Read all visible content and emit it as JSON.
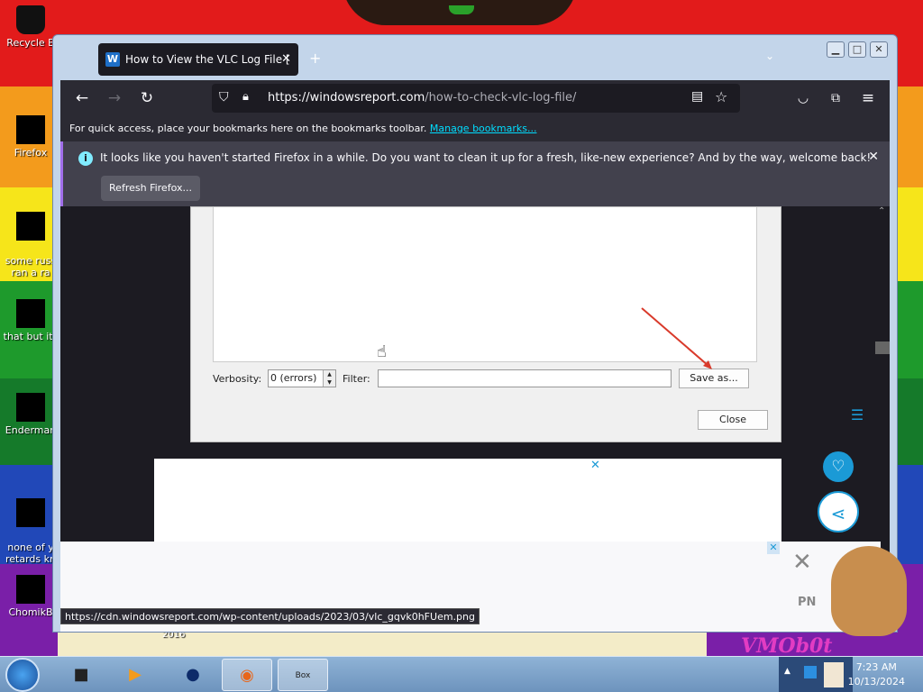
{
  "desktop": {
    "icons": [
      {
        "label": "Recycle B"
      },
      {
        "label": "Firefox"
      },
      {
        "label": "some russ\nran a ra"
      },
      {
        "label": "that but its"
      },
      {
        "label": "Enderman"
      },
      {
        "label": "none of y\nretards kn"
      },
      {
        "label": "ChomikB"
      }
    ],
    "wallpaper_text": "VMOb0t",
    "wallpaper_small": "2016"
  },
  "browser": {
    "tab_title": "How to View the VLC Log File [",
    "tab_favicon": "W",
    "new_tab": "+",
    "url_domain": "https://windowsreport.com",
    "url_path": "/how-to-check-vlc-log-file/",
    "bookmarks_text": "For quick access, place your bookmarks here on the bookmarks toolbar.",
    "bookmarks_link": "Manage bookmarks...",
    "notice_text": "It looks like you haven't started Firefox in a while. Do you want to clean it up for a fresh, like-new experience? And by the way, welcome back!",
    "refresh_button": "Refresh Firefox...",
    "status_url": "https://cdn.windowsreport.com/wp-content/uploads/2023/03/vlc_gqvk0hFUem.png"
  },
  "vlc_dialog": {
    "verbosity_label": "Verbosity:",
    "verbosity_value": "0 (errors)",
    "filter_label": "Filter:",
    "save_as": "Save as...",
    "close": "Close"
  },
  "ad": {
    "pn": "PN"
  },
  "taskbar": {
    "time": "7:23 AM",
    "date": "10/13/2024",
    "box_label": "Box"
  },
  "colors": {
    "accent_purple": "#a16eea",
    "link_cyan": "#00ddff",
    "fab_blue": "#1b9ad6"
  }
}
